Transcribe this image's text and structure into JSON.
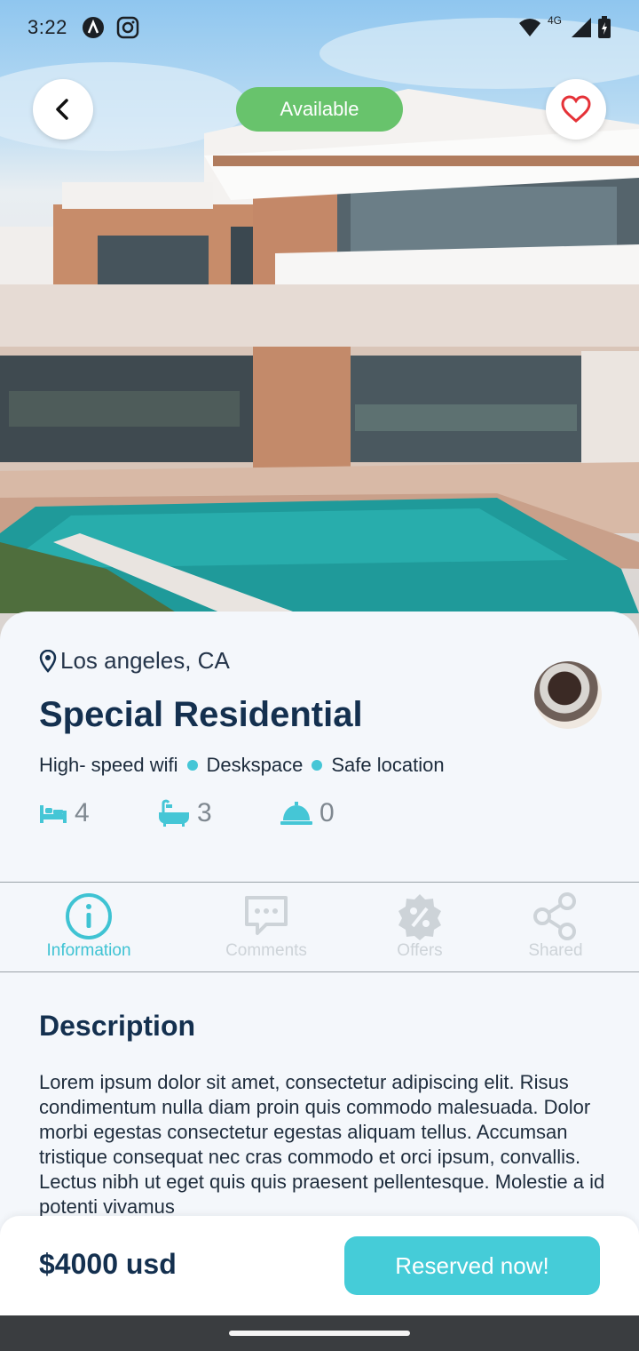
{
  "status_bar": {
    "time": "3:22",
    "icons": [
      "notification-a-icon",
      "instagram-icon",
      "wifi-icon",
      "4g-signal-icon",
      "battery-charging-icon"
    ],
    "network_label": "4G"
  },
  "hero": {
    "badge": "Available",
    "back_icon": "chevron-left-icon",
    "favorite_icon": "heart-outline-icon"
  },
  "property": {
    "location": "Los angeles, CA",
    "title": "Special Residential",
    "features": [
      "High- speed wifi",
      "Deskspace",
      "Safe location"
    ],
    "amenities": [
      {
        "icon": "bed-icon",
        "count": "4"
      },
      {
        "icon": "bathtub-icon",
        "count": "3"
      },
      {
        "icon": "service-bell-icon",
        "count": "0"
      }
    ]
  },
  "tabs": [
    {
      "label": "Information",
      "icon": "info-icon",
      "active": true
    },
    {
      "label": "Comments",
      "icon": "comment-icon",
      "active": false
    },
    {
      "label": "Offers",
      "icon": "discount-icon",
      "active": false
    },
    {
      "label": "Shared",
      "icon": "share-icon",
      "active": false
    }
  ],
  "description": {
    "heading": "Description",
    "text": "Lorem ipsum dolor sit amet, consectetur adipiscing elit. Risus condimentum nulla diam proin quis commodo malesuada. Dolor morbi egestas consectetur egestas aliquam tellus. Accumsan tristique consequat nec cras commodo et orci ipsum, convallis. Lectus nibh ut eget quis quis praesent pellentesque. Molestie a id potenti vivamus"
  },
  "footer": {
    "price": "$4000 usd",
    "reserve_label": "Reserved now!"
  },
  "colors": {
    "accent": "#45ccd8",
    "available": "#68c36c",
    "title": "#14304f"
  }
}
